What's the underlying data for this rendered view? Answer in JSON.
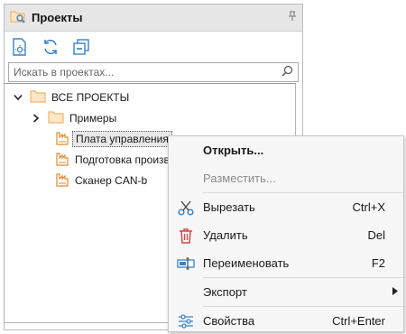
{
  "panel": {
    "title": "Проекты",
    "pin_icon": "pin-icon",
    "toolbar": [
      {
        "name": "new-project-button",
        "icon": "new-project-icon"
      },
      {
        "name": "refresh-button",
        "icon": "refresh-icon"
      },
      {
        "name": "collapse-all-button",
        "icon": "collapse-all-icon"
      }
    ]
  },
  "search": {
    "placeholder": "Искать в проектах...",
    "value": ""
  },
  "tree": {
    "root": "ВСЕ ПРОЕКТЫ",
    "folder": "Примеры",
    "projects": [
      "Плата управления",
      "Подготовка производства",
      "Сканер CAN-b"
    ]
  },
  "menu": {
    "open": "Открыть...",
    "place": "Разместить...",
    "cut": "Вырезать",
    "cut_shortcut": "Ctrl+X",
    "delete": "Удалить",
    "delete_shortcut": "Del",
    "rename": "Переименовать",
    "rename_shortcut": "F2",
    "export": "Экспорт",
    "properties": "Свойства",
    "properties_shortcut": "Ctrl+Enter"
  },
  "colors": {
    "folder": "#f2b56b",
    "folder_fill": "#fde7c7",
    "accent_blue": "#3b82c4",
    "delete_red": "#d64545",
    "project": "#e38a2e"
  }
}
